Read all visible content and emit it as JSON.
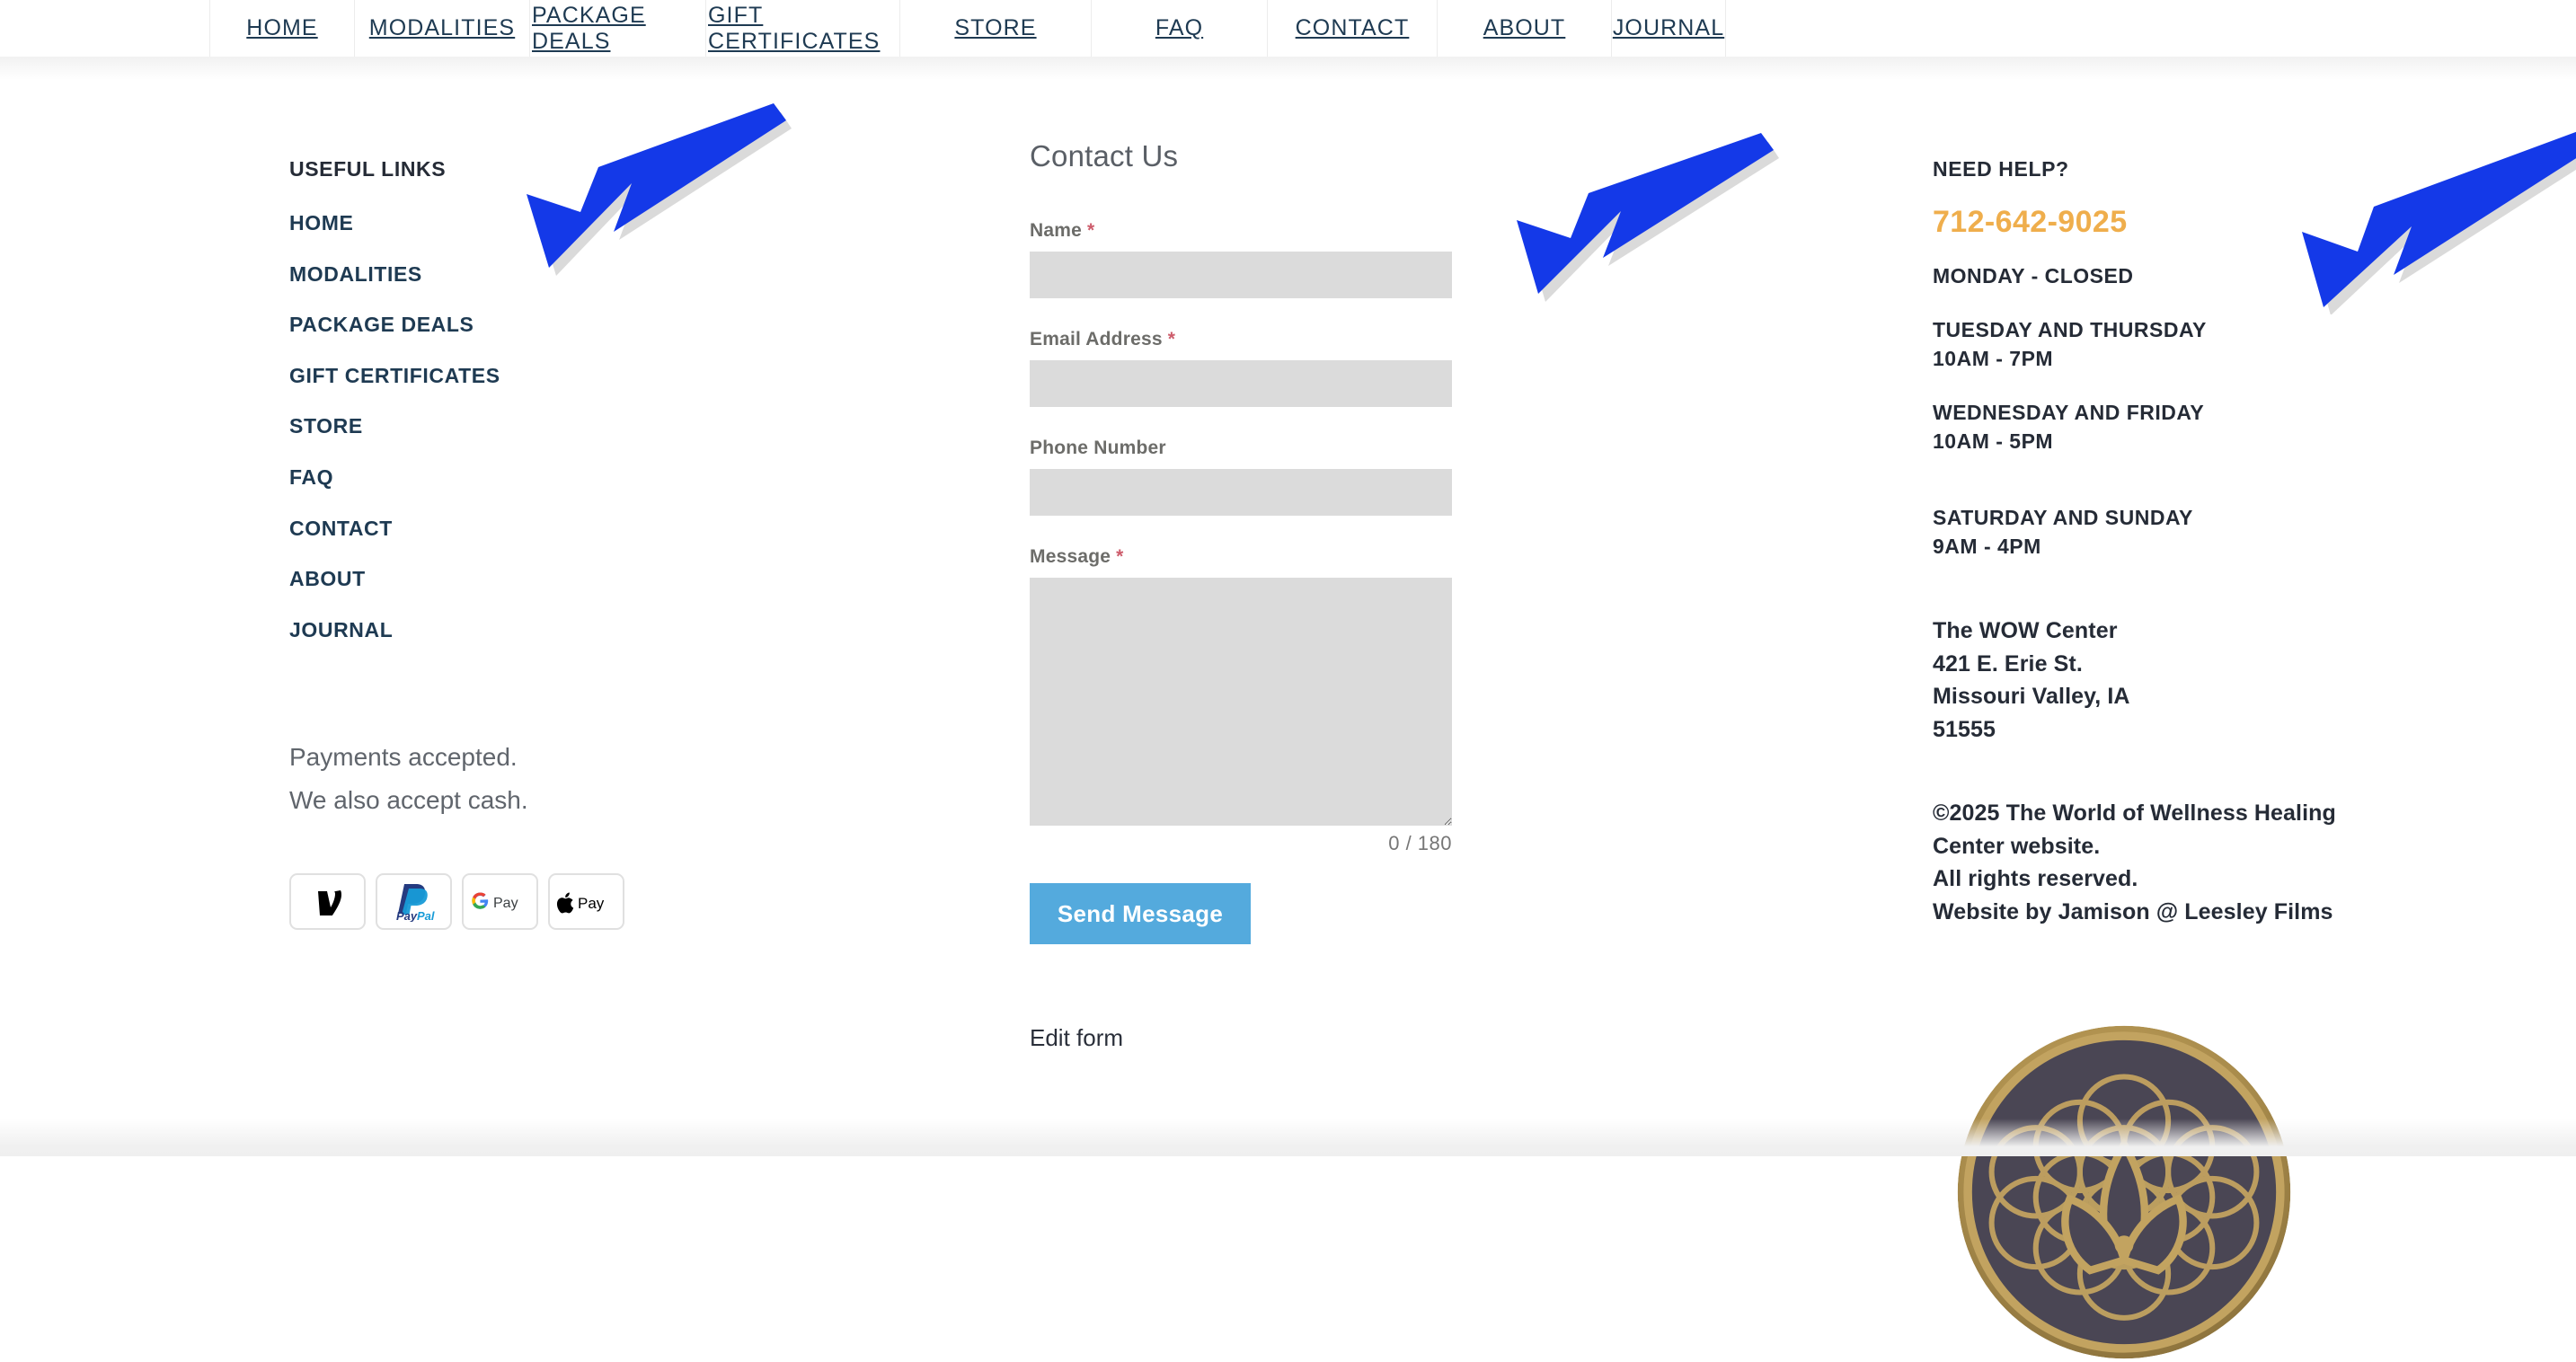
{
  "topnav": {
    "items": [
      {
        "label": "HOME"
      },
      {
        "label": "MODALITIES"
      },
      {
        "label": "PACKAGE DEALS"
      },
      {
        "label": "GIFT CERTIFICATES"
      },
      {
        "label": "STORE"
      },
      {
        "label": "FAQ"
      },
      {
        "label": "CONTACT"
      },
      {
        "label": "ABOUT"
      },
      {
        "label": "JOURNAL"
      }
    ]
  },
  "footer": {
    "useful_links": {
      "heading": "USEFUL LINKS",
      "items": [
        {
          "label": "HOME"
        },
        {
          "label": "MODALITIES"
        },
        {
          "label": "PACKAGE DEALS"
        },
        {
          "label": "GIFT CERTIFICATES"
        },
        {
          "label": "STORE"
        },
        {
          "label": "FAQ"
        },
        {
          "label": "CONTACT"
        },
        {
          "label": "ABOUT"
        },
        {
          "label": "JOURNAL"
        }
      ]
    },
    "payments": {
      "line1": "Payments accepted.",
      "line2": "We also accept cash.",
      "badges": [
        {
          "name": "venmo",
          "label": "Venmo"
        },
        {
          "name": "paypal",
          "label": "PayPal"
        },
        {
          "name": "google-pay",
          "label": "G Pay"
        },
        {
          "name": "apple-pay",
          "label": "Apple Pay"
        }
      ]
    }
  },
  "contact_form": {
    "title": "Contact Us",
    "fields": {
      "name": {
        "label": "Name",
        "required_mark": "*",
        "value": "",
        "placeholder": ""
      },
      "email": {
        "label": "Email Address",
        "required_mark": "*",
        "value": "",
        "placeholder": ""
      },
      "phone": {
        "label": "Phone Number",
        "required_mark": "",
        "value": "",
        "placeholder": ""
      },
      "message": {
        "label": "Message",
        "required_mark": "*",
        "value": "",
        "placeholder": ""
      }
    },
    "char_counter": "0 / 180",
    "submit_label": "Send Message",
    "edit_form_label": "Edit form"
  },
  "need_help": {
    "heading": "NEED HELP?",
    "phone": "712-642-9025",
    "hours": [
      {
        "days": "MONDAY - CLOSED",
        "time": ""
      },
      {
        "days": "TUESDAY AND THURSDAY",
        "time": "10AM - 7PM"
      },
      {
        "days": "WEDNESDAY AND FRIDAY",
        "time": "10AM - 5PM"
      },
      {
        "days": "SATURDAY AND SUNDAY",
        "time": "9AM - 4PM"
      }
    ],
    "address": {
      "line1": "The WOW Center",
      "line2": "421 E. Erie St.",
      "line3": "Missouri Valley, IA",
      "line4": "51555"
    },
    "copyright": {
      "line1": "©2025 The World of Wellness Healing",
      "line2": "Center website.",
      "line3": "All rights reserved.",
      "line4": "Website by Jamison @ Leesley Films"
    }
  },
  "colors": {
    "nav_text": "#1e3a52",
    "heading_text": "#252b36",
    "phone_accent": "#efae4c",
    "button_blue": "#54aadd",
    "field_gray": "#dbdbdb",
    "required_red": "#cd5c6b",
    "annotation_blue": "#1439e8"
  }
}
